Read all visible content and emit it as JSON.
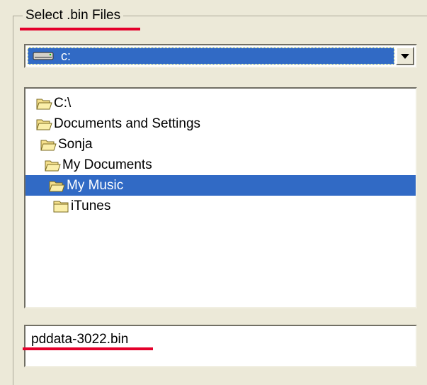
{
  "group": {
    "title": "Select .bin Files"
  },
  "drive": {
    "selected": "c:",
    "icon": "drive-icon"
  },
  "folders": [
    {
      "name": "C:\\",
      "icon": "open-folder-icon",
      "selected": false
    },
    {
      "name": "Documents and Settings",
      "icon": "open-folder-icon",
      "selected": false
    },
    {
      "name": "Sonja",
      "icon": "open-folder-icon",
      "selected": false
    },
    {
      "name": "My Documents",
      "icon": "open-folder-icon",
      "selected": false
    },
    {
      "name": "My Music",
      "icon": "open-folder-icon",
      "selected": true
    },
    {
      "name": "iTunes",
      "icon": "closed-folder-icon",
      "selected": false
    }
  ],
  "file": {
    "name": "pddata-3022.bin"
  },
  "colors": {
    "selection": "#316ac5",
    "annotation": "#e4002b",
    "face": "#ece9d8"
  }
}
